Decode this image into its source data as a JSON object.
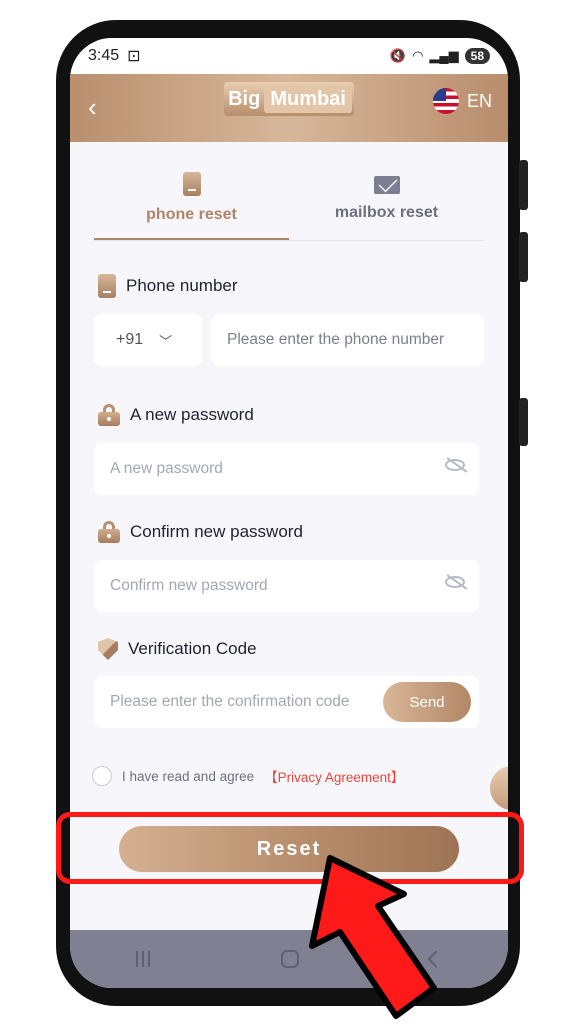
{
  "status_bar": {
    "time": "3:45",
    "battery": "58"
  },
  "header": {
    "logo_part1": "Big",
    "logo_part2": "Mumbai",
    "language": "EN"
  },
  "tabs": [
    {
      "label": "phone reset",
      "active": true,
      "icon": "sim-card-icon"
    },
    {
      "label": "mailbox reset",
      "active": false,
      "icon": "mail-icon"
    }
  ],
  "form": {
    "phone": {
      "label": "Phone number",
      "country_code": "+91",
      "placeholder": "Please enter the phone number"
    },
    "new_password": {
      "label": "A new password",
      "placeholder": "A new password"
    },
    "confirm_password": {
      "label": "Confirm new password",
      "placeholder": "Confirm new password"
    },
    "verification": {
      "label": "Verification Code",
      "placeholder": "Please enter the confirmation code",
      "send_label": "Send"
    },
    "agreement": {
      "text": "I have read and agree",
      "link": "【Privacy Agreement】"
    },
    "reset_label": "Reset"
  },
  "colors": {
    "accent": "#b08566",
    "highlight": "#ff1a1a",
    "link": "#e6483d"
  }
}
